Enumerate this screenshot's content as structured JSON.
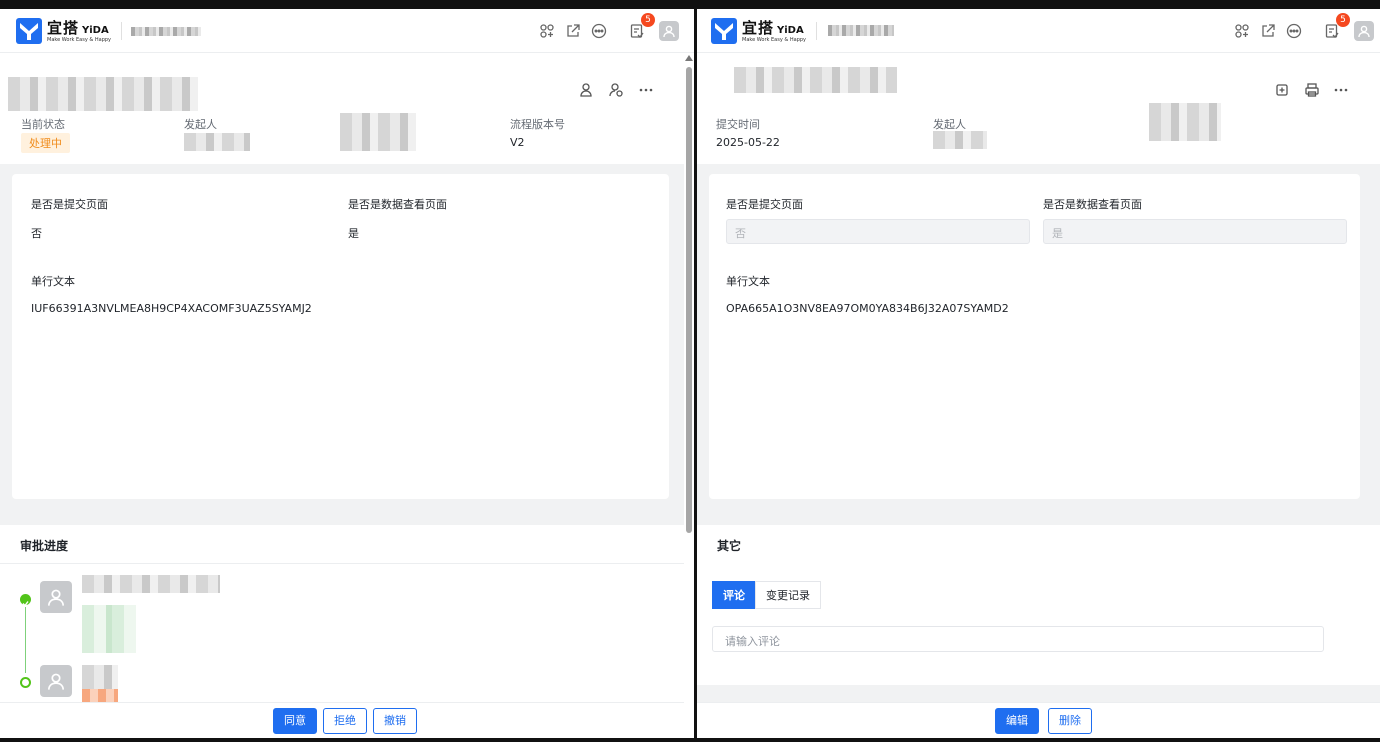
{
  "header": {
    "brand": "宜搭",
    "brand_en": "YiDA",
    "slogan": "Make Work Easy & Happy",
    "notification_count": "5"
  },
  "left_pane": {
    "info": {
      "status_label": "当前状态",
      "status_value": "处理中",
      "initiator_label": "发起人",
      "version_label": "流程版本号",
      "version_value": "V2"
    },
    "form": {
      "field1_label": "是否是提交页面",
      "field1_value": "否",
      "field2_label": "是否是数据查看页面",
      "field2_value": "是",
      "text_label": "单行文本",
      "text_value": "IUF66391A3NVLMEA8H9CP4XACOMF3UAZ5SYAMJ2"
    },
    "approval": {
      "title": "审批进度"
    },
    "footer": {
      "agree": "同意",
      "reject": "拒绝",
      "revoke": "撤销"
    }
  },
  "right_pane": {
    "info": {
      "submit_time_label": "提交时间",
      "submit_time_value": "2025-05-22",
      "initiator_label": "发起人"
    },
    "form": {
      "field1_label": "是否是提交页面",
      "field1_value": "否",
      "field2_label": "是否是数据查看页面",
      "field2_value": "是",
      "text_label": "单行文本",
      "text_value": "OPA665A1O3NV8EA97OM0YA834B6J32A07SYAMD2"
    },
    "other": {
      "title": "其它",
      "tab_comment": "评论",
      "tab_changelog": "变更记录",
      "comment_placeholder": "请输入评论"
    },
    "footer": {
      "edit": "编辑",
      "delete": "删除"
    }
  },
  "colors": {
    "primary": "#1f6ef0",
    "status_processing": "#f08c1c",
    "success": "#52c41a",
    "badge": "#f5481f"
  }
}
